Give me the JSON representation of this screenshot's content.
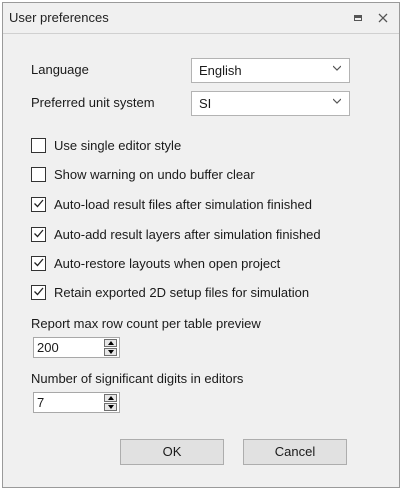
{
  "window": {
    "title": "User preferences",
    "restore_icon": "restore-icon",
    "close_icon": "close-icon"
  },
  "language": {
    "label": "Language",
    "value": "English",
    "icon": "chevron-down-icon"
  },
  "unit_system": {
    "label": "Preferred unit system",
    "value": "SI",
    "icon": "chevron-down-icon"
  },
  "options": [
    {
      "label": "Use single editor style",
      "checked": false
    },
    {
      "label": "Show warning on undo buffer clear",
      "checked": false
    },
    {
      "label": "Auto-load result files after simulation finished",
      "checked": true
    },
    {
      "label": "Auto-add result layers after simulation finished",
      "checked": true
    },
    {
      "label": "Auto-restore layouts when open project",
      "checked": true
    },
    {
      "label": "Retain exported 2D setup files for simulation",
      "checked": true
    }
  ],
  "max_rows": {
    "label": "Report max row count per table preview",
    "value": "200"
  },
  "sig_digits": {
    "label": "Number of significant digits in editors",
    "value": "7"
  },
  "buttons": {
    "ok": "OK",
    "cancel": "Cancel"
  }
}
